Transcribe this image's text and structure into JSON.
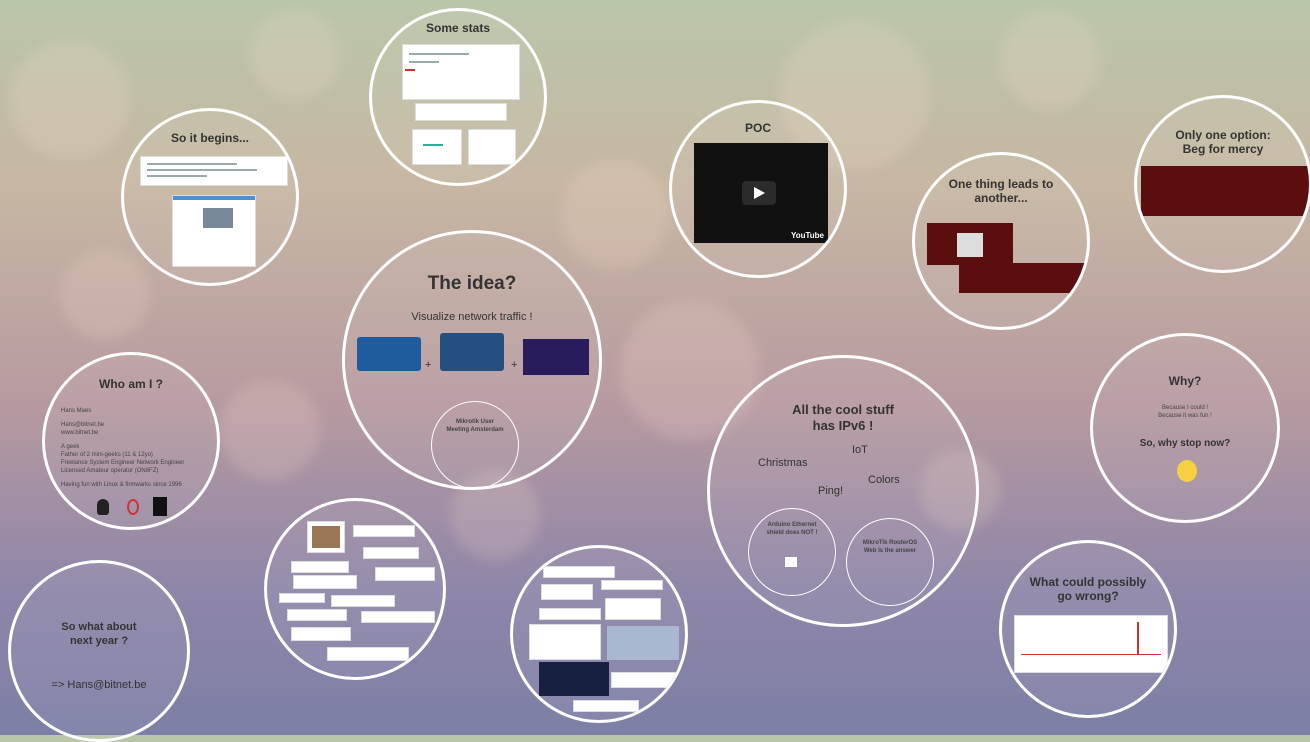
{
  "stats": {
    "title": "Some stats"
  },
  "begins": {
    "title": "So it begins..."
  },
  "idea": {
    "title": "The idea?",
    "subtitle": "Visualize network traffic !",
    "plus1": "+",
    "plus2": "+",
    "inner_title": "Mikrotik User Meeting Amsterdam"
  },
  "who": {
    "title": "Who am I ?",
    "lines": [
      "Hans Maes",
      "Hans@bitnet.be",
      "www.bitnet.be",
      "A geek",
      "Father of 2 mini-geeks (11 & 12yo)",
      "Freelance System Engineer Network Engineer",
      "Licensed Amateur operator (ON8FZ)",
      "Having fun with Linux & firmwarks since 1996"
    ]
  },
  "next_year": {
    "title_1": "So what about",
    "title_2": "next year ?",
    "email": "=> Hans@bitnet.be"
  },
  "poc": {
    "title": "POC",
    "youtube": "YouTube"
  },
  "one_thing": {
    "title_1": "One thing leads to",
    "title_2": "another..."
  },
  "beg": {
    "title_1": "Only one option:",
    "title_2": "Beg for mercy"
  },
  "ipv6": {
    "title_1": "All the cool stuff",
    "title_2": "has IPv6 !",
    "christmas": "Christmas",
    "iot": "IoT",
    "colors": "Colors",
    "ping": "Ping!",
    "inner1": "Arduino Ethernet shield does NOT !",
    "inner2": "MikroTik RouterOS Web Is the answer"
  },
  "why": {
    "title": "Why?",
    "line1": "Because I could !",
    "line2": "Because it was fun !",
    "stop": "So, why stop now?"
  },
  "wrong": {
    "title_1": "What could possibly",
    "title_2": "go wrong?"
  },
  "icons": [
    "penguin-icon",
    "daemon-icon",
    "terminal-icon",
    "play-icon",
    "thinking-emoji-icon"
  ]
}
